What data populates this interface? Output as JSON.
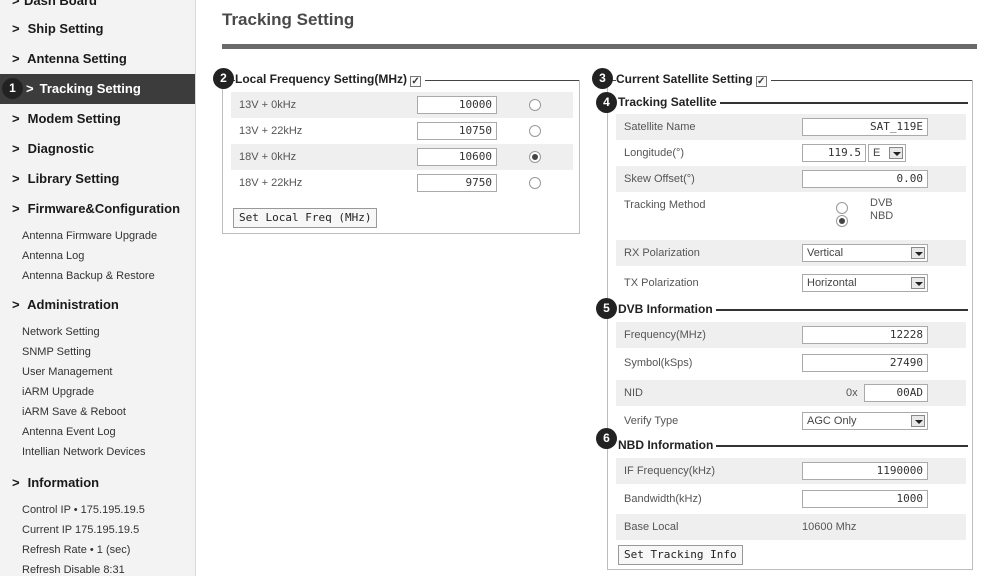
{
  "sidebar": {
    "dash_board": "Dash Board",
    "ship_setting": "Ship Setting",
    "antenna_setting": "Antenna Setting",
    "tracking_setting": "Tracking Setting",
    "modem_setting": "Modem Setting",
    "diagnostic": "Diagnostic",
    "library_setting": "Library Setting",
    "firmware_config": "Firmware&Configuration",
    "firmware_items": [
      "Antenna Firmware Upgrade",
      "Antenna Log",
      "Antenna Backup & Restore"
    ],
    "administration": "Administration",
    "admin_items": [
      "Network Setting",
      "SNMP Setting",
      "User Management",
      "iARM Upgrade",
      "iARM Save & Reboot",
      "Antenna Event Log",
      "Intellian Network Devices"
    ],
    "information": "Information",
    "info_items": [
      "Control IP • 175.195.19.5",
      "Current IP  175.195.19.5",
      "Refresh Rate •    1 (sec)",
      "Refresh Disable  8:31"
    ]
  },
  "callouts": [
    "1",
    "2",
    "3",
    "4",
    "5",
    "6"
  ],
  "page_title": "Tracking Setting",
  "local_freq": {
    "legend": "Local Frequency Setting(MHz)",
    "rows": [
      {
        "label": "13V + 0kHz",
        "value": "10000",
        "selected": false
      },
      {
        "label": "13V + 22kHz",
        "value": "10750",
        "selected": false
      },
      {
        "label": "18V + 0kHz",
        "value": "10600",
        "selected": true
      },
      {
        "label": "18V + 22kHz",
        "value": "9750",
        "selected": false
      }
    ],
    "button": "Set Local Freq (MHz)"
  },
  "current_sat": {
    "legend": "Current Satellite Setting",
    "tracking_satellite": {
      "title": "Tracking Satellite",
      "satellite_name_label": "Satellite Name",
      "satellite_name_value": "SAT_119E",
      "longitude_label": "Longitude(°)",
      "longitude_value": "119.5",
      "longitude_dir": "E",
      "skew_label": "Skew Offset(°)",
      "skew_value": "0.00",
      "method_label": "Tracking Method",
      "method_dvb": "DVB",
      "method_nbd": "NBD",
      "method_selected": "NBD",
      "rx_label": "RX Polarization",
      "rx_value": "Vertical",
      "tx_label": "TX Polarization",
      "tx_value": "Horizontal"
    },
    "dvb": {
      "title": "DVB Information",
      "freq_label": "Frequency(MHz)",
      "freq_value": "12228",
      "symbol_label": "Symbol(kSps)",
      "symbol_value": "27490",
      "nid_label": "NID",
      "nid_prefix": "0x",
      "nid_value": "00AD",
      "verify_label": "Verify Type",
      "verify_value": "AGC Only"
    },
    "nbd": {
      "title": "NBD Information",
      "if_label": "IF Frequency(kHz)",
      "if_value": "1190000",
      "bw_label": "Bandwidth(kHz)",
      "bw_value": "1000",
      "base_label": "Base Local",
      "base_value": "10600 Mhz"
    },
    "button": "Set Tracking Info"
  }
}
